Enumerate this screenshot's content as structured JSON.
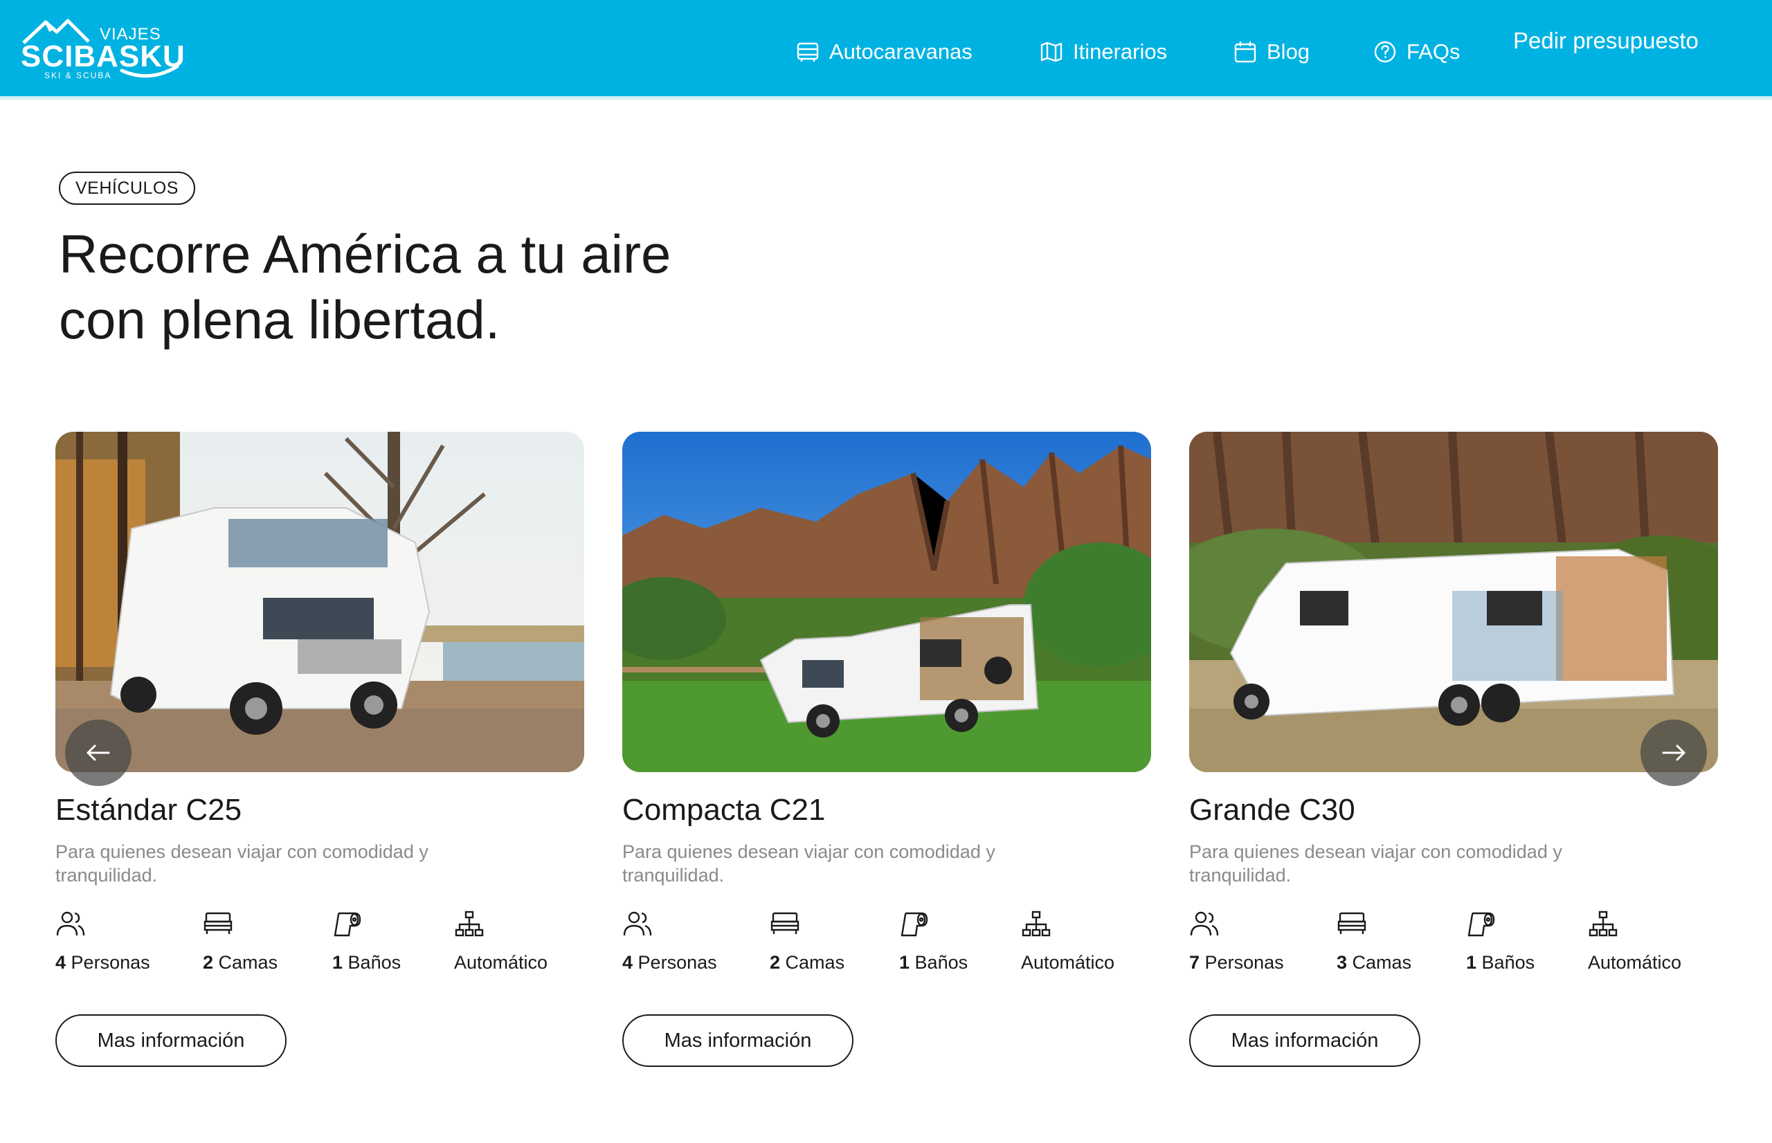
{
  "brand": {
    "top": "VIAJES",
    "name": "SCIBASKU",
    "tagline": "SKI & SCUBA"
  },
  "nav": {
    "items": [
      {
        "label": "Autocaravanas",
        "icon": "caravan-icon"
      },
      {
        "label": "Itinerarios",
        "icon": "map-icon"
      },
      {
        "label": "Blog",
        "icon": "calendar-icon"
      },
      {
        "label": "FAQs",
        "icon": "help-circle-icon"
      }
    ],
    "cta": "Pedir presupuesto"
  },
  "hero": {
    "tag": "VEHÍCULOS",
    "title_line1": "Recorre América a tu aire",
    "title_line2": "con plena libertad."
  },
  "vehicles": [
    {
      "title": "Estándar C25",
      "description": "Para quienes desean viajar con comodidad y tranquilidad.",
      "specs": [
        {
          "value": "4",
          "label": "Personas",
          "icon": "people-icon"
        },
        {
          "value": "2",
          "label": "Camas",
          "icon": "bed-icon"
        },
        {
          "value": "1",
          "label": "Baños",
          "icon": "toilet-paper-icon"
        },
        {
          "value": "",
          "label": "Automático",
          "icon": "transmission-icon"
        }
      ],
      "button": "Mas información"
    },
    {
      "title": "Compacta C21",
      "description": "Para quienes desean viajar con comodidad y tranquilidad.",
      "specs": [
        {
          "value": "4",
          "label": "Personas",
          "icon": "people-icon"
        },
        {
          "value": "2",
          "label": "Camas",
          "icon": "bed-icon"
        },
        {
          "value": "1",
          "label": "Baños",
          "icon": "toilet-paper-icon"
        },
        {
          "value": "",
          "label": "Automático",
          "icon": "transmission-icon"
        }
      ],
      "button": "Mas información"
    },
    {
      "title": "Grande C30",
      "description": "Para quienes desean viajar con comodidad y tranquilidad.",
      "specs": [
        {
          "value": "7",
          "label": "Personas",
          "icon": "people-icon"
        },
        {
          "value": "3",
          "label": "Camas",
          "icon": "bed-icon"
        },
        {
          "value": "1",
          "label": "Baños",
          "icon": "toilet-paper-icon"
        },
        {
          "value": "",
          "label": "Automático",
          "icon": "transmission-icon"
        }
      ],
      "button": "Mas información"
    }
  ],
  "carousel": {
    "prev_icon": "arrow-left-icon",
    "next_icon": "arrow-right-icon"
  },
  "colors": {
    "header": "#00b2e1",
    "text": "#1a1a1a",
    "muted": "#8a8a8a"
  }
}
